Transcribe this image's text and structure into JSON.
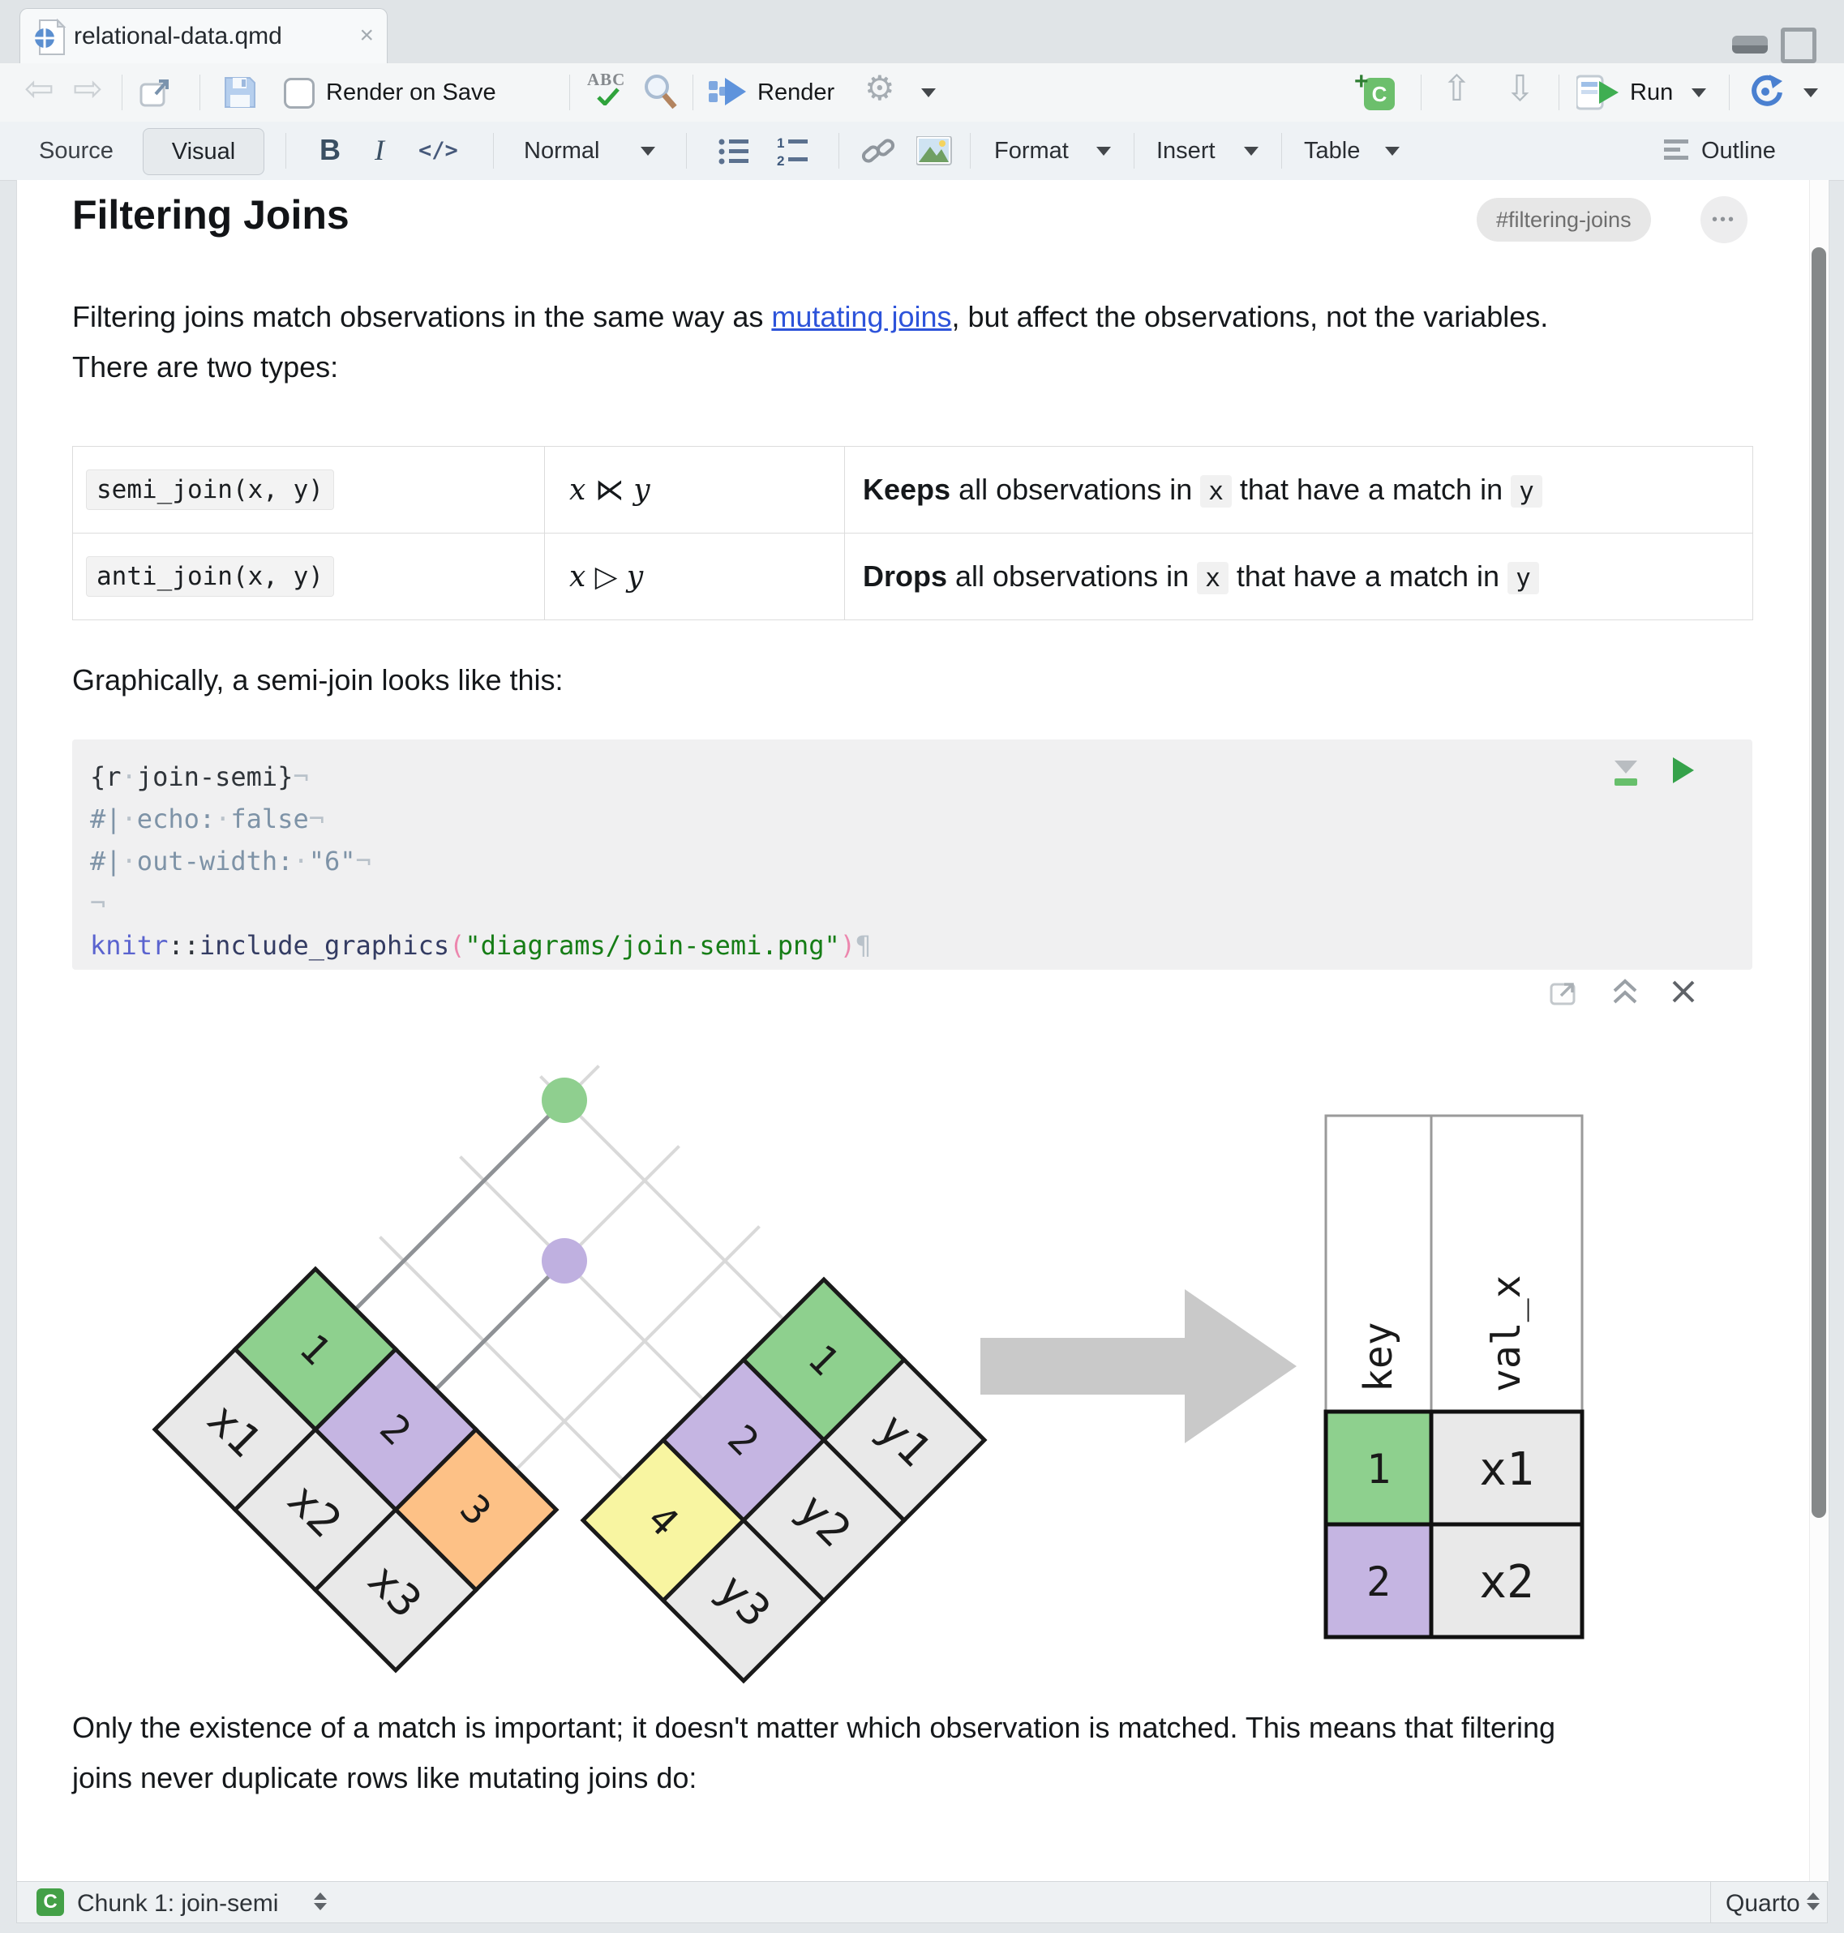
{
  "tab": {
    "title": "relational-data.qmd",
    "close": "×"
  },
  "icons": {
    "back": "⇦",
    "forward": "⇨",
    "up": "⇧",
    "down": "⇩",
    "gear": "⚙",
    "ellipsis": "•••",
    "abc": "ABC",
    "close_output": "✕"
  },
  "toolbar": {
    "render_on_save": "Render on Save",
    "render": "Render",
    "run": "Run",
    "source": "Source",
    "visual": "Visual",
    "bold": "B",
    "italic": "I",
    "code": "</>",
    "normal": "Normal",
    "format": "Format",
    "insert": "Insert",
    "table": "Table",
    "outline": "Outline"
  },
  "doc": {
    "heading": "Filtering Joins",
    "anchor_badge": "#filtering-joins",
    "p1": {
      "before": "Filtering joins match observations in the same way as ",
      "link": "mutating joins",
      "after": ", but affect the observations, not the variables. There are two types:"
    },
    "join_table": {
      "rows": [
        {
          "code": "semi_join(x, y)",
          "math": "x ⋉ y",
          "bold": "Keeps",
          "t1": " all observations in ",
          "k1": "x",
          "t2": " that have a match in ",
          "k2": "y"
        },
        {
          "code": "anti_join(x, y)",
          "math": "x ▷ y",
          "bold": "Drops",
          "t1": " all observations in ",
          "k1": "x",
          "t2": " that have a match in ",
          "k2": "y"
        }
      ]
    },
    "p2": "Graphically, a semi-join looks like this:",
    "p3": "Only the existence of a match is important; it doesn't matter which observation is matched. This means that filtering joins never duplicate rows like mutating joins do:"
  },
  "chunk": {
    "lines": [
      [
        {
          "t": "{r",
          "c": "src"
        },
        {
          "t": "·",
          "c": "invis"
        },
        {
          "t": "join-semi}",
          "c": "src"
        },
        {
          "t": "¬",
          "c": "invis"
        }
      ],
      [
        {
          "t": "#|",
          "c": "meta"
        },
        {
          "t": "·",
          "c": "invis"
        },
        {
          "t": "echo:",
          "c": "meta"
        },
        {
          "t": "·",
          "c": "invis"
        },
        {
          "t": "false",
          "c": "meta"
        },
        {
          "t": "¬",
          "c": "invis"
        }
      ],
      [
        {
          "t": "#|",
          "c": "meta"
        },
        {
          "t": "·",
          "c": "invis"
        },
        {
          "t": "out-width:",
          "c": "meta"
        },
        {
          "t": "·",
          "c": "invis"
        },
        {
          "t": "\"6\"",
          "c": "meta"
        },
        {
          "t": "¬",
          "c": "invis"
        }
      ],
      [
        {
          "t": "¬",
          "c": "invis"
        }
      ],
      [
        {
          "t": "knitr",
          "c": "pkg"
        },
        {
          "t": "::",
          "c": "src"
        },
        {
          "t": "include_graphics",
          "c": "fn"
        },
        {
          "t": "(",
          "c": "paren"
        },
        {
          "t": "\"diagrams/join-semi.png\"",
          "c": "str"
        },
        {
          "t": ")",
          "c": "paren"
        },
        {
          "t": "¶",
          "c": "invis"
        }
      ]
    ]
  },
  "diagram": {
    "x_table": {
      "keys": [
        "1",
        "2",
        "3"
      ],
      "vals": [
        "x1",
        "x2",
        "x3"
      ]
    },
    "y_table": {
      "keys": [
        "4",
        "2",
        "1"
      ],
      "vals": [
        "y3",
        "y2",
        "y1"
      ]
    },
    "result": {
      "headers": [
        "key",
        "val_x"
      ],
      "rows": [
        [
          "1",
          "x1"
        ],
        [
          "2",
          "x2"
        ]
      ]
    },
    "colors": {
      "key_green": "#8ed08e",
      "key_purple": "#c5b5e2",
      "key_orange": "#fdc186",
      "key_yellow": "#f8f5a1",
      "cell_gray": "#e9e9e9",
      "dot_green": "#8fcf8f",
      "dot_purple": "#bfb0e0",
      "arrow_gray": "#c9c9c9"
    }
  },
  "statusbar": {
    "chunk": "Chunk 1: join-semi",
    "lang": "Quarto"
  },
  "colors": {
    "link": "#2d53da",
    "run_green": "#3fae52",
    "render_blue": "#5e93dc"
  }
}
